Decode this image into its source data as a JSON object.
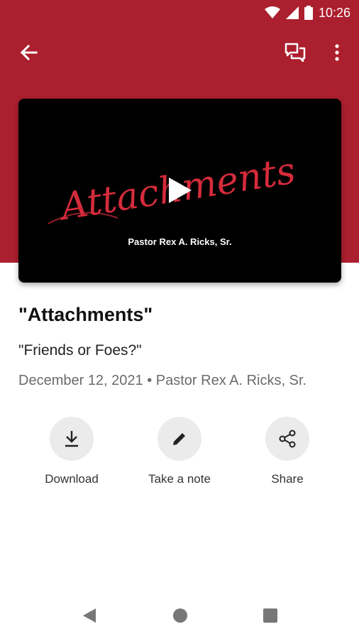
{
  "status_bar": {
    "time": "10:26",
    "icons": [
      "wifi-icon",
      "signal-icon",
      "battery-icon"
    ]
  },
  "app_bar": {
    "icons": [
      "back-arrow-icon",
      "chat-icon",
      "more-vert-icon"
    ]
  },
  "video": {
    "script_title": "Attachments",
    "pastor_overlay": "Pastor Rex A. Ricks, Sr.",
    "play_icon": "play-icon"
  },
  "sermon": {
    "title": "\"Attachments\"",
    "subtitle": "\"Friends or Foes?\"",
    "meta": "December 12, 2021 • Pastor Rex A. Ricks, Sr."
  },
  "actions": [
    {
      "label": "Download",
      "icon": "download-icon"
    },
    {
      "label": "Take a note",
      "icon": "pencil-icon"
    },
    {
      "label": "Share",
      "icon": "share-icon"
    }
  ],
  "nav": {
    "icons": [
      "nav-back-icon",
      "nav-home-icon",
      "nav-recents-icon"
    ]
  },
  "colors": {
    "brand_red": "#ac1f2e",
    "script_red": "#d42b3c",
    "action_bg": "#ebebeb",
    "meta_gray": "#6b6b6b"
  }
}
